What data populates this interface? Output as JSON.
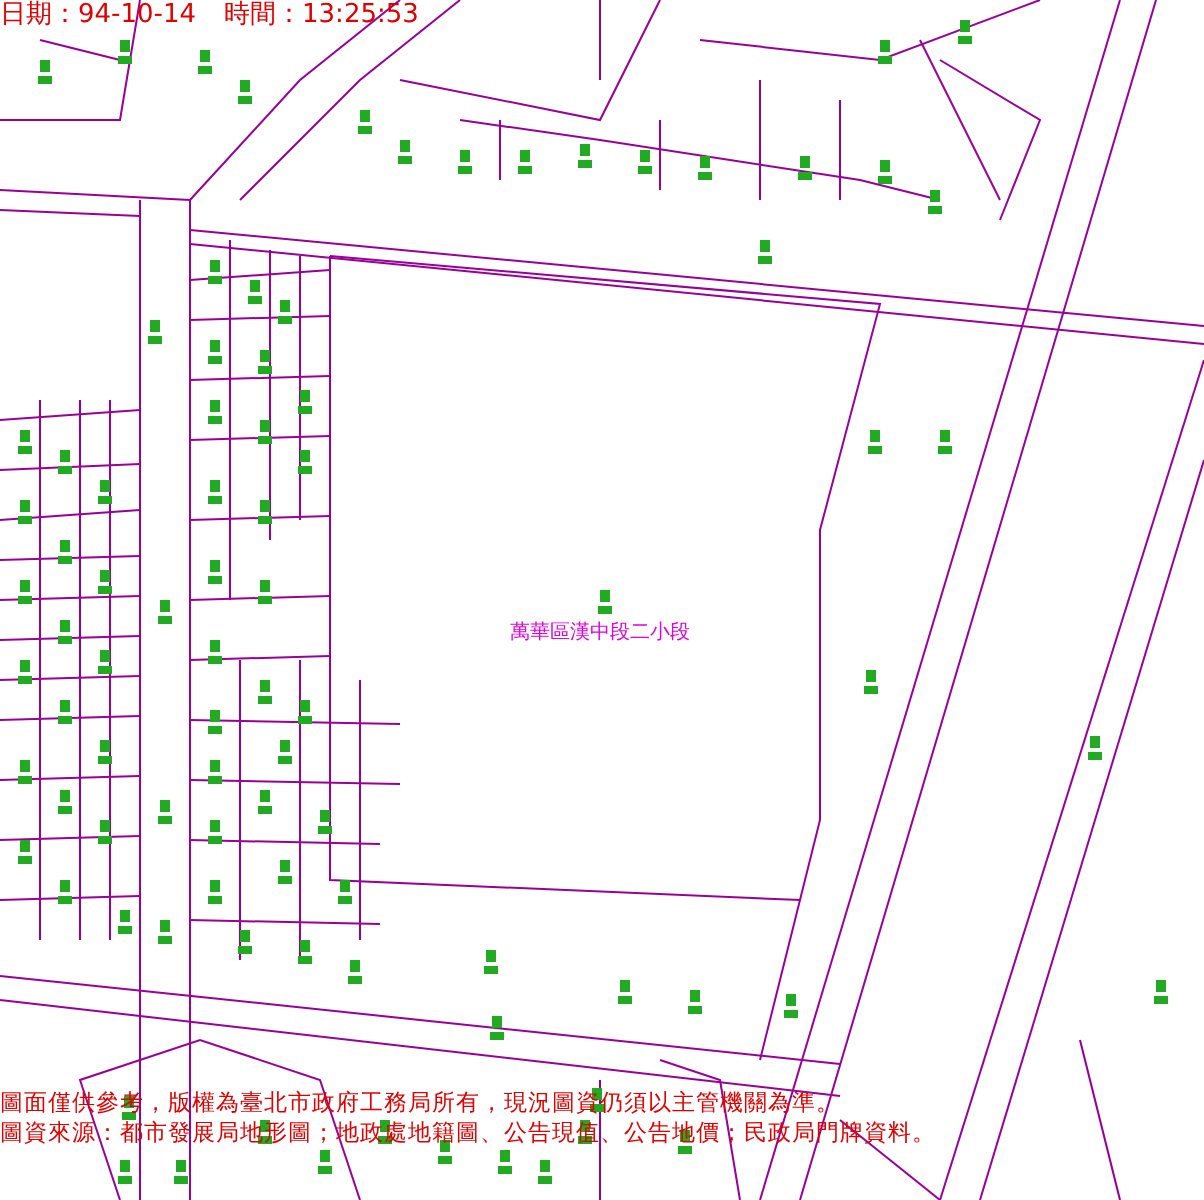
{
  "header": {
    "date_label": "日期：94-10-14",
    "time_label": "時間：13:25:53"
  },
  "map": {
    "section_label": "萬華區漢中段二小段"
  },
  "footer": {
    "lines": [
      "圖面僅供參考，版權為臺北市政府工務局所有，現況圖資仍須以主管機關為準。",
      "圖資來源：都市發展局地形圖；地政處地籍圖、公告現值、公告地價；民政局門牌資料。"
    ]
  }
}
